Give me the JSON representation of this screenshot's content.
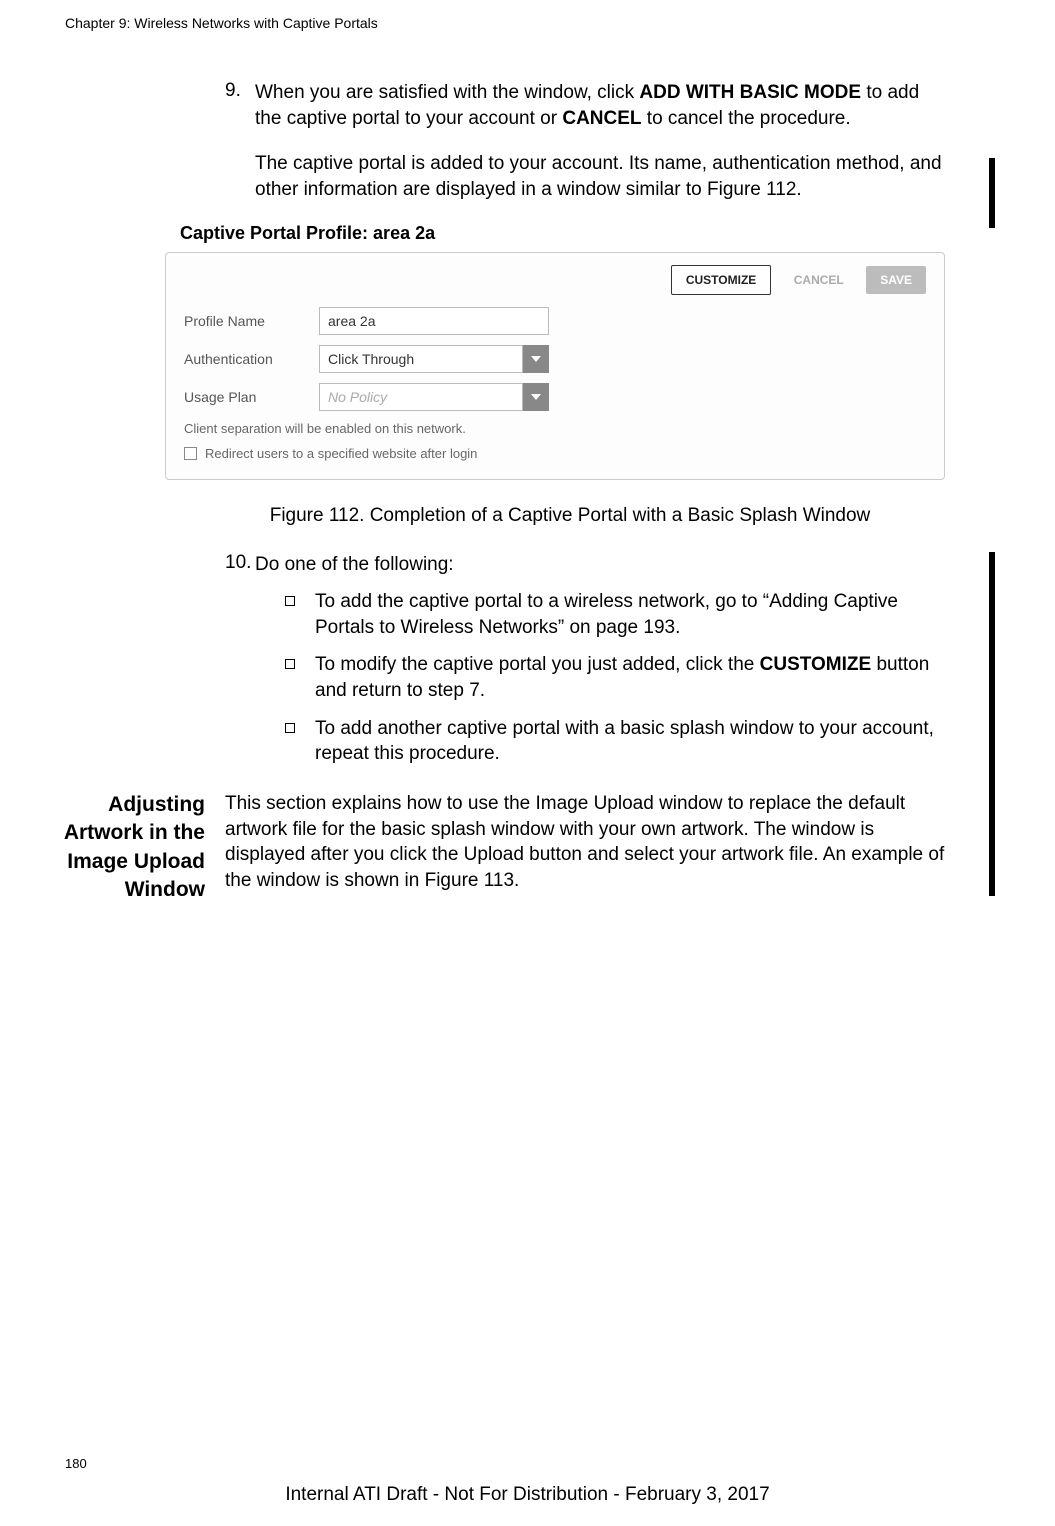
{
  "header": {
    "chapter": "Chapter 9: Wireless Networks with Captive Portals"
  },
  "step9": {
    "num": "9.",
    "text_parts": [
      "When you are satisfied with the window, click ",
      "ADD WITH BASIC MODE",
      " to add the captive portal to your account or ",
      "CANCEL",
      " to cancel the procedure."
    ]
  },
  "step9_result": "The captive portal is added to your account. Its name, authentication method, and other information are displayed in a window similar to Figure 112.",
  "figure": {
    "title_prefix": "Captive Portal Profile: ",
    "title_name": "area 2a",
    "buttons": {
      "customize": "CUSTOMIZE",
      "cancel": "CANCEL",
      "save": "SAVE"
    },
    "rows": {
      "profile_name_label": "Profile Name",
      "profile_name_value": "area 2a",
      "authentication_label": "Authentication",
      "authentication_value": "Click Through",
      "usage_plan_label": "Usage Plan",
      "usage_plan_value": "No Policy"
    },
    "helper": "Client separation will be enabled on this network.",
    "checkbox_label": "Redirect users to a specified website after login"
  },
  "figure_caption": "Figure 112. Completion of a Captive Portal with a Basic Splash Window",
  "step10": {
    "num": "10.",
    "text": "Do one of the following:"
  },
  "sub_items": [
    {
      "parts": [
        "To add the captive portal to a wireless network, go to “Adding Captive Portals to Wireless Networks” on page 193."
      ]
    },
    {
      "parts": [
        "To modify the captive portal you just added, click the ",
        "CUSTOMIZE",
        " button and return to step 7."
      ]
    },
    {
      "parts": [
        "To add another captive portal with a basic splash window to your account, repeat this procedure."
      ]
    }
  ],
  "section": {
    "heading": "Adjusting Artwork in the Image Upload Window",
    "body": "This section explains how to use the Image Upload window to replace the default artwork file for the basic splash window with your own artwork. The window is displayed after you click the Upload button and select your artwork file. An example of the window is shown in Figure 113."
  },
  "page_number": "180",
  "footer": "Internal ATI Draft - Not For Distribution - February 3, 2017"
}
